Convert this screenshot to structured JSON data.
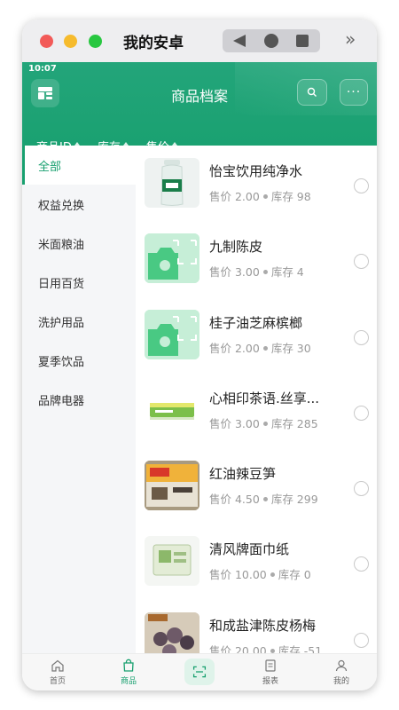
{
  "emulator": {
    "title": "我的安卓"
  },
  "status_bar": {
    "time": "10:07"
  },
  "header": {
    "title": "商品档案",
    "more_label": "···"
  },
  "sort_bar": [
    {
      "label": "商品ID"
    },
    {
      "label": "库存"
    },
    {
      "label": "售价"
    }
  ],
  "sidebar": {
    "items": [
      {
        "label": "全部",
        "active": true
      },
      {
        "label": "权益兑换"
      },
      {
        "label": "米面粮油"
      },
      {
        "label": "日用百货"
      },
      {
        "label": "洗护用品"
      },
      {
        "label": "夏季饮品"
      },
      {
        "label": "品牌电器"
      }
    ]
  },
  "products": [
    {
      "name": "怡宝饮用纯净水",
      "price": "售价 2.00",
      "stock": "库存 98",
      "image": "water-bottle"
    },
    {
      "name": "九制陈皮",
      "price": "售价 3.00",
      "stock": "库存 4",
      "image": "placeholder"
    },
    {
      "name": "桂子油芝麻槟榔",
      "price": "售价 2.00",
      "stock": "库存 30",
      "image": "placeholder"
    },
    {
      "name": "心相印茶语.丝享...",
      "price": "售价 3.00",
      "stock": "库存 285",
      "image": "tissue-pack"
    },
    {
      "name": "红油辣豆笋",
      "price": "售价 4.50",
      "stock": "库存 299",
      "image": "snack-box"
    },
    {
      "name": "清风牌面巾纸",
      "price": "售价 10.00",
      "stock": "库存 0",
      "image": "tissue-box"
    },
    {
      "name": "和成盐津陈皮杨梅",
      "price": "售价 20.00",
      "stock": "库存 -51",
      "image": "plum-bag"
    }
  ],
  "tabbar": {
    "home": "首页",
    "goods": "商品",
    "report": "报表",
    "mine": "我的"
  },
  "colors": {
    "accent": "#18a06f",
    "sidebar_bg": "#f5f6f8"
  }
}
